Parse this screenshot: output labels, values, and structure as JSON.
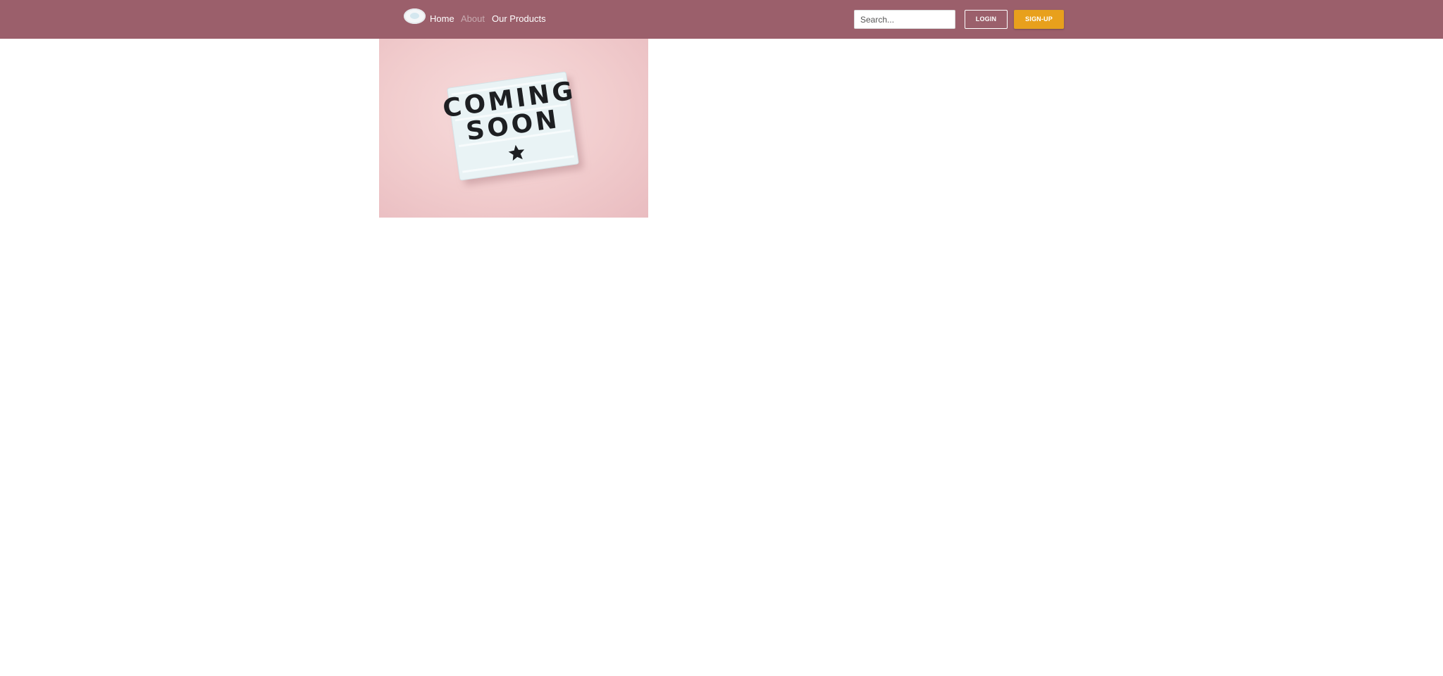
{
  "nav": {
    "links": [
      {
        "label": "Home",
        "active": false
      },
      {
        "label": "About",
        "active": true
      },
      {
        "label": "Our Products",
        "active": false
      }
    ]
  },
  "search": {
    "placeholder": "Search..."
  },
  "actions": {
    "login_label": "LOGIN",
    "signup_label": "SIGN-UP"
  },
  "hero": {
    "sign_line1": "COMING",
    "sign_line2": "SOON"
  },
  "colors": {
    "navbar": "#9b5f6b",
    "signup": "#e8a01c",
    "hero_background": "#f1cccd"
  }
}
